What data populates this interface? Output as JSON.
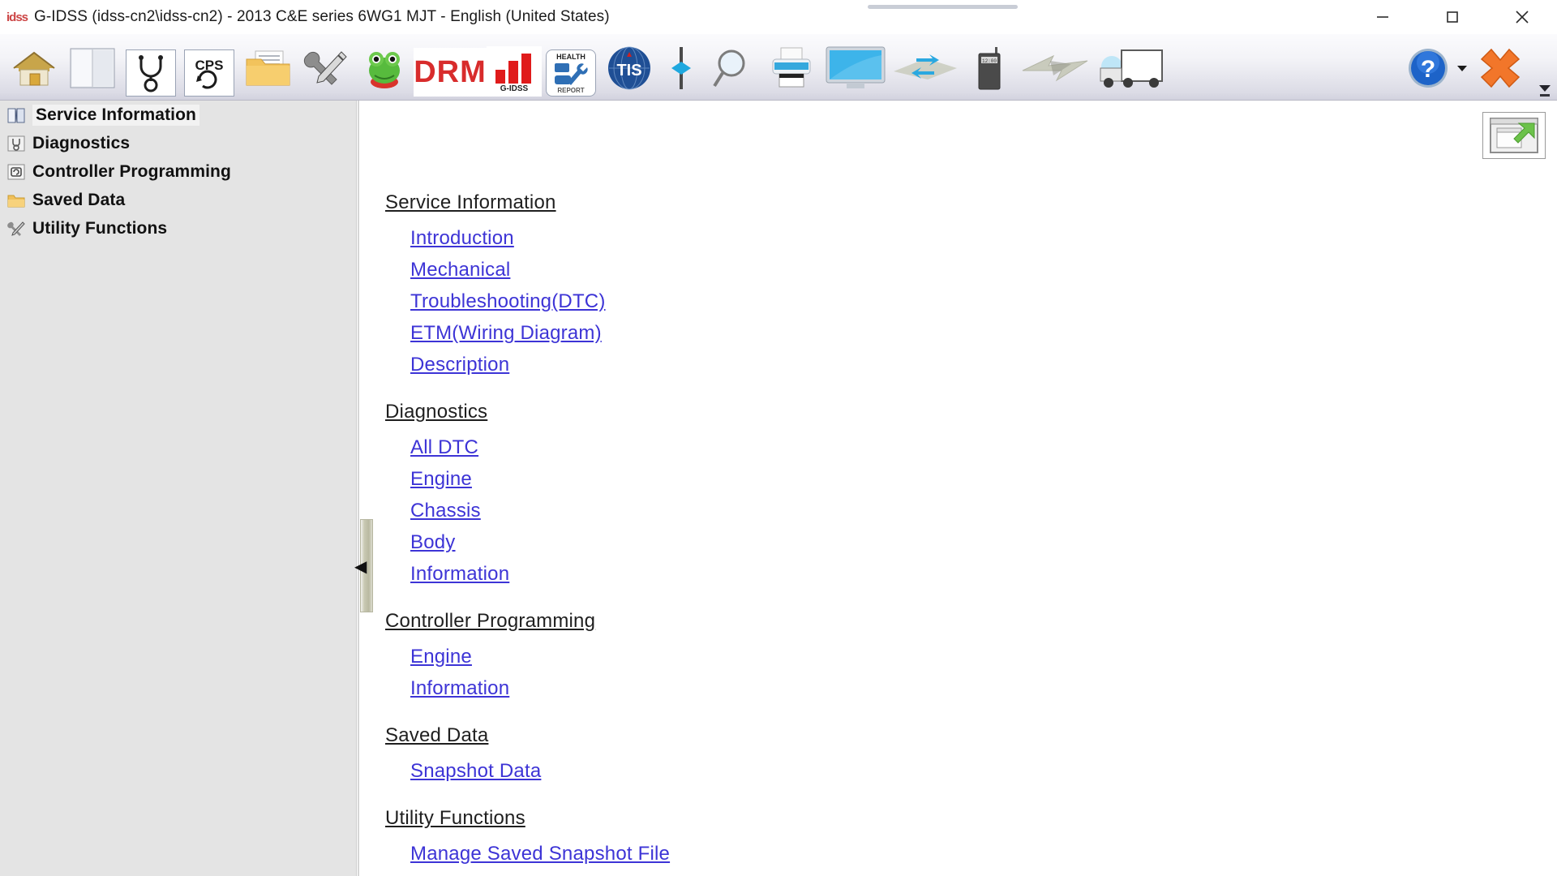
{
  "window": {
    "app_icon_text": "idss",
    "title": "G-IDSS (idss-cn2\\idss-cn2) - 2013 C&E series 6WG1 MJT - English (United States)",
    "controls": {
      "minimize": "minimize-button",
      "maximize": "maximize-button",
      "close": "close-button"
    }
  },
  "toolbar": {
    "items": [
      {
        "name": "home-icon",
        "label": "Home"
      },
      {
        "name": "manual-book-icon",
        "label": "Manual"
      },
      {
        "name": "stethoscope-icon",
        "label": "Diagnostics"
      },
      {
        "name": "cps-icon",
        "label": "CPS"
      },
      {
        "name": "folder-icon",
        "label": "Saved Data"
      },
      {
        "name": "tools-icon",
        "label": "Utility Functions"
      },
      {
        "name": "frog-icon",
        "label": "Frog"
      },
      {
        "name": "drm-icon",
        "label": "DRM"
      },
      {
        "name": "bar-chart-icon",
        "label": "G-IDSS"
      },
      {
        "name": "health-report-icon",
        "label": "HEALTH REPORT"
      },
      {
        "name": "tis-icon",
        "label": "TIS"
      },
      {
        "name": "probe-icon",
        "label": "Probe"
      },
      {
        "name": "magnifier-icon",
        "label": "Search"
      },
      {
        "name": "printer-icon",
        "label": "Print"
      },
      {
        "name": "monitor-icon",
        "label": "Display"
      },
      {
        "name": "sync-arrows-icon",
        "label": "Sync"
      },
      {
        "name": "handheld-device-icon",
        "label": "Device"
      },
      {
        "name": "lightning-bolt-icon",
        "label": "Quick"
      },
      {
        "name": "truck-icon",
        "label": "Vehicle"
      }
    ],
    "drm_text": "DRM",
    "gidss_text": "G-IDSS",
    "health_text": "HEALTH",
    "report_text": "REPORT",
    "cps_text": "CPS",
    "tis_text": "TIS",
    "help_label": "Help",
    "exit_label": "Exit"
  },
  "sidebar": {
    "items": [
      {
        "label": "Service Information",
        "icon": "book-icon",
        "selected": true
      },
      {
        "label": "Diagnostics",
        "icon": "diagnostics-icon",
        "selected": false
      },
      {
        "label": "Controller Programming",
        "icon": "controller-icon",
        "selected": false
      },
      {
        "label": "Saved Data",
        "icon": "folder-icon",
        "selected": false
      },
      {
        "label": "Utility Functions",
        "icon": "tools-icon",
        "selected": false
      }
    ]
  },
  "splitter": {
    "collapse_arrow": "◀"
  },
  "content": {
    "sections": [
      {
        "heading": "Service Information",
        "links": [
          "Introduction",
          "Mechanical",
          "Troubleshooting(DTC)",
          "ETM(Wiring Diagram)",
          "Description"
        ]
      },
      {
        "heading": "Diagnostics",
        "links": [
          "All DTC",
          "Engine",
          "Chassis",
          "Body",
          "Information"
        ]
      },
      {
        "heading": "Controller Programming",
        "links": [
          "Engine",
          "Information"
        ]
      },
      {
        "heading": "Saved Data",
        "links": [
          "Snapshot Data"
        ]
      },
      {
        "heading": "Utility Functions",
        "links": [
          "Manage Saved Snapshot File"
        ]
      }
    ]
  },
  "panel_button": {
    "name": "restore-window-icon"
  },
  "colors": {
    "link": "#3d34d6",
    "heading": "#1f1f1f",
    "sidebar_bg": "#e4e4e4",
    "toolbar_top": "#fbfbfd",
    "toolbar_bottom": "#d2d2de",
    "drm_red": "#d82c2c",
    "splitter": "#c2c2ab"
  }
}
